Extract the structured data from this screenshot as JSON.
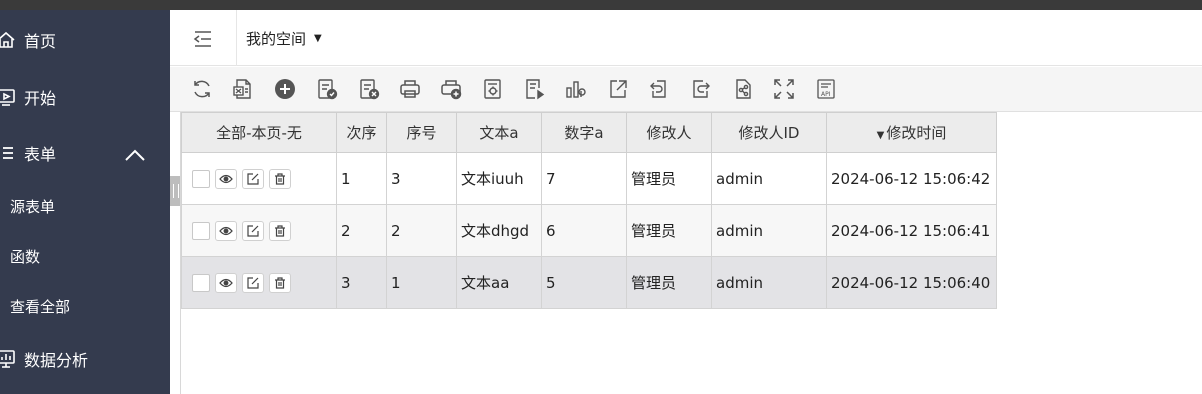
{
  "sidebar": {
    "items": [
      {
        "label": "首页",
        "icon": "home-icon"
      },
      {
        "label": "开始",
        "icon": "play-screen-icon"
      },
      {
        "label": "表单",
        "icon": "list-icon",
        "expanded": true
      },
      {
        "label": "数据分析",
        "icon": "chart-board-icon"
      }
    ],
    "sub_items": [
      {
        "label": "源表单"
      },
      {
        "label": "函数"
      },
      {
        "label": "查看全部"
      }
    ]
  },
  "header": {
    "space_label": "我的空间"
  },
  "toolbar": {
    "buttons": [
      "refresh-icon",
      "excel-export-icon",
      "add-icon",
      "submit-icon",
      "cancel-submit-icon",
      "print-icon",
      "print-add-icon",
      "settings-doc-icon",
      "run-doc-icon",
      "chart-icon",
      "share-out-icon",
      "undo-doc-icon",
      "redo-doc-icon",
      "share-link-icon",
      "fullscreen-icon",
      "api-doc-icon"
    ]
  },
  "table": {
    "headers": [
      "全部-本页-无",
      "次序",
      "序号",
      "文本a",
      "数字a",
      "修改人",
      "修改人ID",
      "修改时间"
    ],
    "sort_column": "修改时间",
    "rows": [
      [
        "1",
        "3",
        "文本iuuh",
        "7",
        "管理员",
        "admin",
        "2024-06-12 15:06:42"
      ],
      [
        "2",
        "2",
        "文本dhgd",
        "6",
        "管理员",
        "admin",
        "2024-06-12 15:06:41"
      ],
      [
        "3",
        "1",
        "文本aa",
        "5",
        "管理员",
        "admin",
        "2024-06-12 15:06:40"
      ]
    ]
  },
  "colors": {
    "sidebar_bg": "#343b4e",
    "toolbar_bg": "#f5f5f5",
    "header_bg": "#ececec",
    "add_button": "#555555"
  }
}
